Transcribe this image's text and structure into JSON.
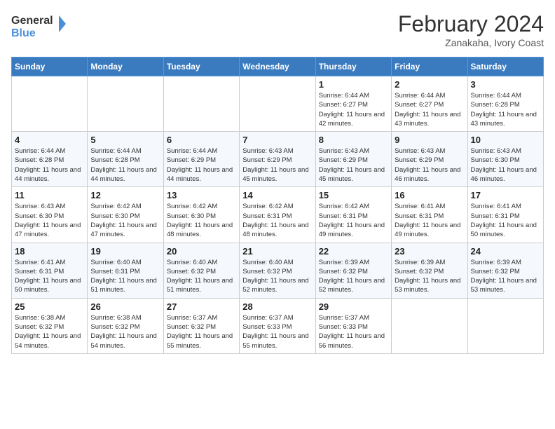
{
  "header": {
    "logo_line1": "General",
    "logo_line2": "Blue",
    "month_year": "February 2024",
    "location": "Zanakaha, Ivory Coast"
  },
  "days_of_week": [
    "Sunday",
    "Monday",
    "Tuesday",
    "Wednesday",
    "Thursday",
    "Friday",
    "Saturday"
  ],
  "weeks": [
    [
      {
        "day": "",
        "info": ""
      },
      {
        "day": "",
        "info": ""
      },
      {
        "day": "",
        "info": ""
      },
      {
        "day": "",
        "info": ""
      },
      {
        "day": "1",
        "info": "Sunrise: 6:44 AM\nSunset: 6:27 PM\nDaylight: 11 hours and 42 minutes."
      },
      {
        "day": "2",
        "info": "Sunrise: 6:44 AM\nSunset: 6:27 PM\nDaylight: 11 hours and 43 minutes."
      },
      {
        "day": "3",
        "info": "Sunrise: 6:44 AM\nSunset: 6:28 PM\nDaylight: 11 hours and 43 minutes."
      }
    ],
    [
      {
        "day": "4",
        "info": "Sunrise: 6:44 AM\nSunset: 6:28 PM\nDaylight: 11 hours and 44 minutes."
      },
      {
        "day": "5",
        "info": "Sunrise: 6:44 AM\nSunset: 6:28 PM\nDaylight: 11 hours and 44 minutes."
      },
      {
        "day": "6",
        "info": "Sunrise: 6:44 AM\nSunset: 6:29 PM\nDaylight: 11 hours and 44 minutes."
      },
      {
        "day": "7",
        "info": "Sunrise: 6:43 AM\nSunset: 6:29 PM\nDaylight: 11 hours and 45 minutes."
      },
      {
        "day": "8",
        "info": "Sunrise: 6:43 AM\nSunset: 6:29 PM\nDaylight: 11 hours and 45 minutes."
      },
      {
        "day": "9",
        "info": "Sunrise: 6:43 AM\nSunset: 6:29 PM\nDaylight: 11 hours and 46 minutes."
      },
      {
        "day": "10",
        "info": "Sunrise: 6:43 AM\nSunset: 6:30 PM\nDaylight: 11 hours and 46 minutes."
      }
    ],
    [
      {
        "day": "11",
        "info": "Sunrise: 6:43 AM\nSunset: 6:30 PM\nDaylight: 11 hours and 47 minutes."
      },
      {
        "day": "12",
        "info": "Sunrise: 6:42 AM\nSunset: 6:30 PM\nDaylight: 11 hours and 47 minutes."
      },
      {
        "day": "13",
        "info": "Sunrise: 6:42 AM\nSunset: 6:30 PM\nDaylight: 11 hours and 48 minutes."
      },
      {
        "day": "14",
        "info": "Sunrise: 6:42 AM\nSunset: 6:31 PM\nDaylight: 11 hours and 48 minutes."
      },
      {
        "day": "15",
        "info": "Sunrise: 6:42 AM\nSunset: 6:31 PM\nDaylight: 11 hours and 49 minutes."
      },
      {
        "day": "16",
        "info": "Sunrise: 6:41 AM\nSunset: 6:31 PM\nDaylight: 11 hours and 49 minutes."
      },
      {
        "day": "17",
        "info": "Sunrise: 6:41 AM\nSunset: 6:31 PM\nDaylight: 11 hours and 50 minutes."
      }
    ],
    [
      {
        "day": "18",
        "info": "Sunrise: 6:41 AM\nSunset: 6:31 PM\nDaylight: 11 hours and 50 minutes."
      },
      {
        "day": "19",
        "info": "Sunrise: 6:40 AM\nSunset: 6:31 PM\nDaylight: 11 hours and 51 minutes."
      },
      {
        "day": "20",
        "info": "Sunrise: 6:40 AM\nSunset: 6:32 PM\nDaylight: 11 hours and 51 minutes."
      },
      {
        "day": "21",
        "info": "Sunrise: 6:40 AM\nSunset: 6:32 PM\nDaylight: 11 hours and 52 minutes."
      },
      {
        "day": "22",
        "info": "Sunrise: 6:39 AM\nSunset: 6:32 PM\nDaylight: 11 hours and 52 minutes."
      },
      {
        "day": "23",
        "info": "Sunrise: 6:39 AM\nSunset: 6:32 PM\nDaylight: 11 hours and 53 minutes."
      },
      {
        "day": "24",
        "info": "Sunrise: 6:39 AM\nSunset: 6:32 PM\nDaylight: 11 hours and 53 minutes."
      }
    ],
    [
      {
        "day": "25",
        "info": "Sunrise: 6:38 AM\nSunset: 6:32 PM\nDaylight: 11 hours and 54 minutes."
      },
      {
        "day": "26",
        "info": "Sunrise: 6:38 AM\nSunset: 6:32 PM\nDaylight: 11 hours and 54 minutes."
      },
      {
        "day": "27",
        "info": "Sunrise: 6:37 AM\nSunset: 6:32 PM\nDaylight: 11 hours and 55 minutes."
      },
      {
        "day": "28",
        "info": "Sunrise: 6:37 AM\nSunset: 6:33 PM\nDaylight: 11 hours and 55 minutes."
      },
      {
        "day": "29",
        "info": "Sunrise: 6:37 AM\nSunset: 6:33 PM\nDaylight: 11 hours and 56 minutes."
      },
      {
        "day": "",
        "info": ""
      },
      {
        "day": "",
        "info": ""
      }
    ]
  ]
}
